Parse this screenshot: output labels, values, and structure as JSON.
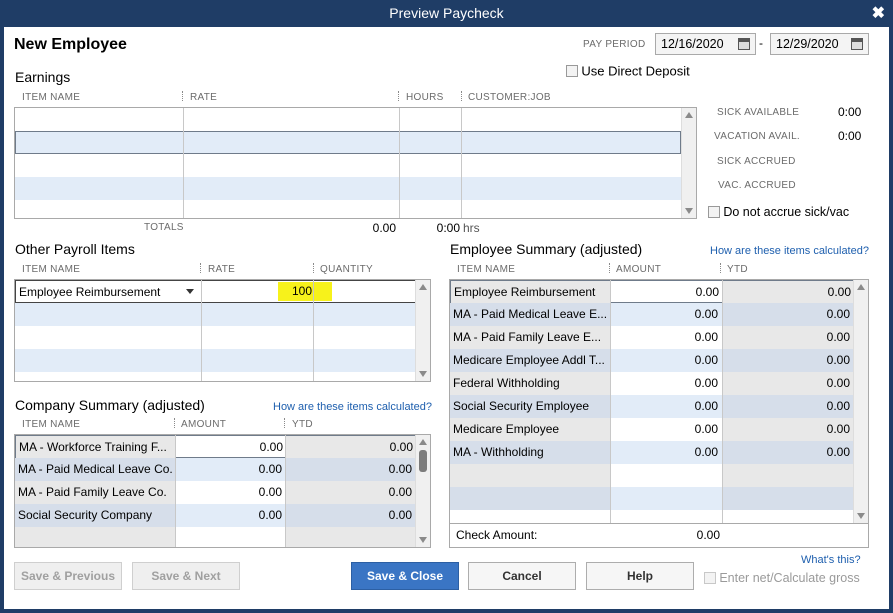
{
  "window": {
    "title": "Preview Paycheck",
    "close_glyph": "✖"
  },
  "header": {
    "employee_name": "New Employee",
    "pay_period_label": "PAY PERIOD",
    "pay_period_start": "12/16/2020",
    "pay_period_separator": "-",
    "pay_period_end": "12/29/2020",
    "direct_deposit_label": "Use Direct Deposit"
  },
  "earnings": {
    "title": "Earnings",
    "columns": [
      "ITEM NAME",
      "RATE",
      "HOURS",
      "CUSTOMER:JOB"
    ],
    "totals_label": "TOTALS",
    "totals_rate": "0.00",
    "totals_hours": "0:00",
    "hours_unit": "hrs"
  },
  "sick_vac": {
    "sick_available_label": "SICK AVAILABLE",
    "sick_available_value": "0:00",
    "vacation_avail_label": "VACATION AVAIL.",
    "vacation_avail_value": "0:00",
    "sick_accrued_label": "SICK ACCRUED",
    "vac_accrued_label": "VAC. ACCRUED",
    "no_accrue_label": "Do not accrue sick/vac"
  },
  "other_payroll": {
    "title": "Other Payroll Items",
    "columns": [
      "ITEM NAME",
      "RATE",
      "QUANTITY"
    ],
    "rows": [
      {
        "item": "Employee Reimbursement",
        "rate": "100",
        "quantity": ""
      }
    ]
  },
  "employee_summary": {
    "title": "Employee Summary (adjusted)",
    "help_link": "How are these items calculated?",
    "columns": [
      "ITEM NAME",
      "AMOUNT",
      "YTD"
    ],
    "rows": [
      {
        "item": "Employee Reimbursement",
        "amount": "0.00",
        "ytd": "0.00"
      },
      {
        "item": "MA - Paid Medical Leave E...",
        "amount": "0.00",
        "ytd": "0.00"
      },
      {
        "item": "MA - Paid Family Leave E...",
        "amount": "0.00",
        "ytd": "0.00"
      },
      {
        "item": "Medicare Employee Addl T...",
        "amount": "0.00",
        "ytd": "0.00"
      },
      {
        "item": "Federal Withholding",
        "amount": "0.00",
        "ytd": "0.00"
      },
      {
        "item": "Social Security Employee",
        "amount": "0.00",
        "ytd": "0.00"
      },
      {
        "item": "Medicare Employee",
        "amount": "0.00",
        "ytd": "0.00"
      },
      {
        "item": "MA - Withholding",
        "amount": "0.00",
        "ytd": "0.00"
      }
    ],
    "check_amount_label": "Check Amount:",
    "check_amount_value": "0.00"
  },
  "company_summary": {
    "title": "Company Summary  (adjusted)",
    "help_link": "How are these items calculated?",
    "columns": [
      "ITEM NAME",
      "AMOUNT",
      "YTD"
    ],
    "rows": [
      {
        "item": "MA - Workforce Training F...",
        "amount": "0.00",
        "ytd": "0.00"
      },
      {
        "item": "MA - Paid Medical Leave Co.",
        "amount": "0.00",
        "ytd": "0.00"
      },
      {
        "item": "MA - Paid Family Leave Co.",
        "amount": "0.00",
        "ytd": "0.00"
      },
      {
        "item": "Social Security Company",
        "amount": "0.00",
        "ytd": "0.00"
      }
    ]
  },
  "footer": {
    "save_previous": "Save & Previous",
    "save_next": "Save & Next",
    "save_close": "Save & Close",
    "cancel": "Cancel",
    "help": "Help",
    "whats_this": "What's this?",
    "enter_net_label": "Enter net/Calculate gross"
  },
  "colors": {
    "row_alt": "#e2ecf8",
    "grey_col": "#e8e8e8",
    "highlight": "#f7f21b",
    "primary": "#3a75c4"
  }
}
